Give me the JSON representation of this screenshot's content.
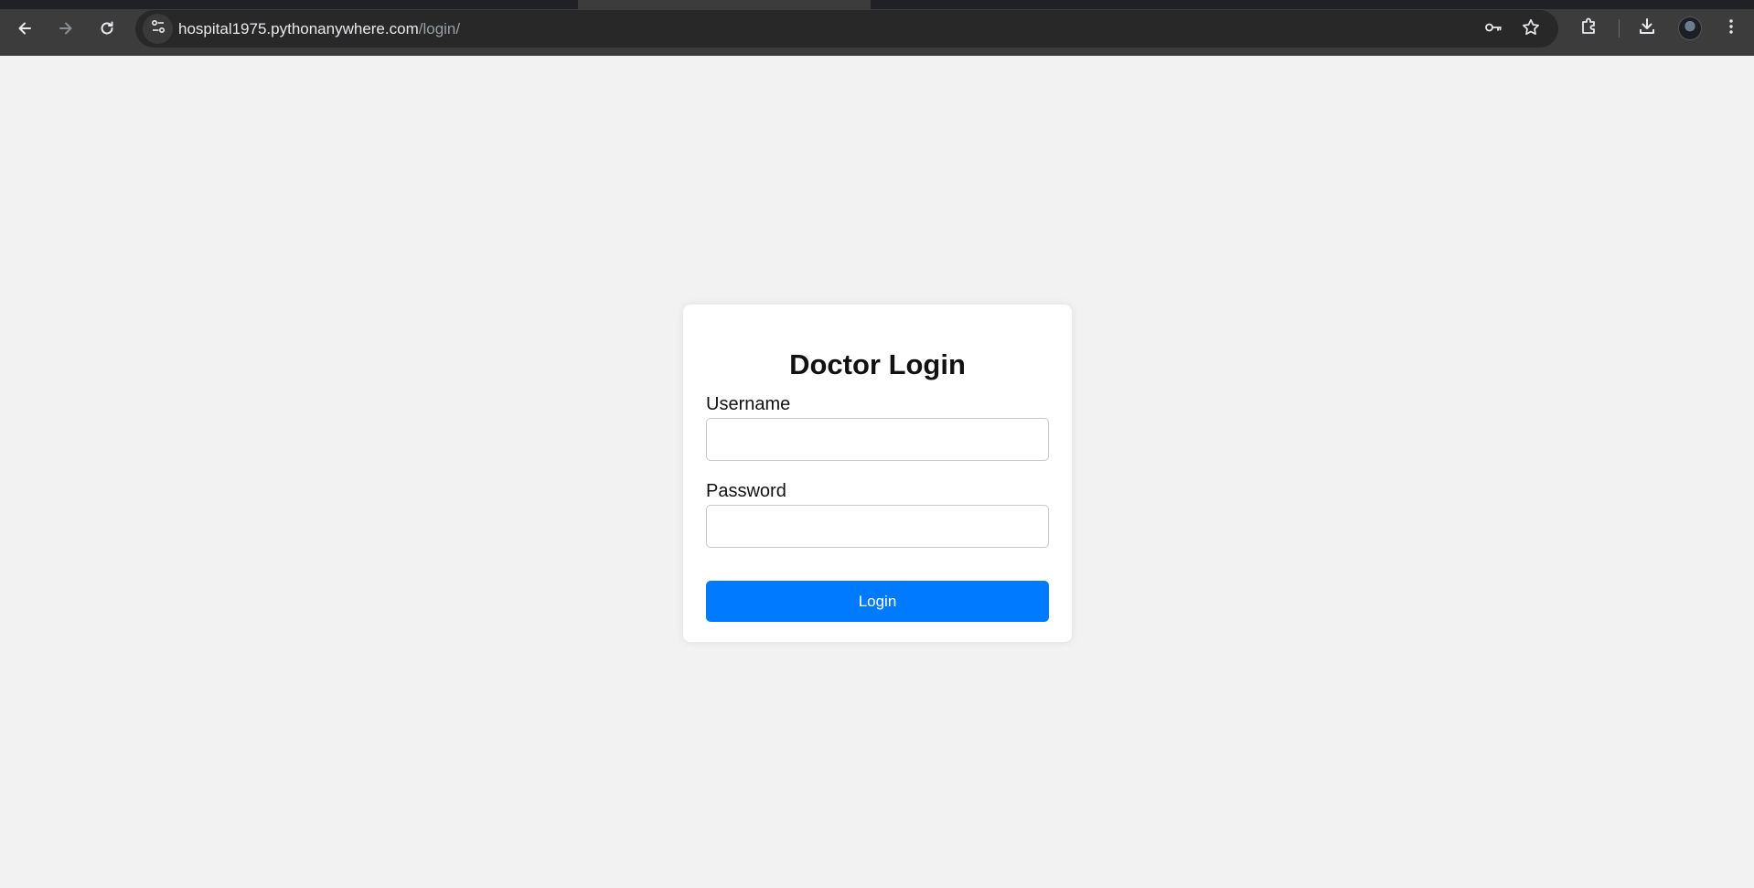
{
  "browser": {
    "url_host": "hospital1975.pythonanywhere.com",
    "url_path": "/login/",
    "icons": {
      "back": "arrow-left-icon",
      "forward": "arrow-right-icon",
      "reload": "reload-icon",
      "site_info": "tune-icon",
      "password": "key-icon",
      "bookmark": "star-icon",
      "extensions": "puzzle-icon",
      "downloads": "download-icon",
      "profile": "avatar",
      "menu": "kebab-menu-icon"
    },
    "colors": {
      "toolbar_bg": "#3c3c3c",
      "omnibox_bg": "#282828"
    }
  },
  "page": {
    "background": "#f2f2f2",
    "login_form": {
      "title": "Doctor Login",
      "username_label": "Username",
      "username_value": "",
      "password_label": "Password",
      "password_value": "",
      "submit_label": "Login",
      "button_color": "#007bff"
    }
  }
}
